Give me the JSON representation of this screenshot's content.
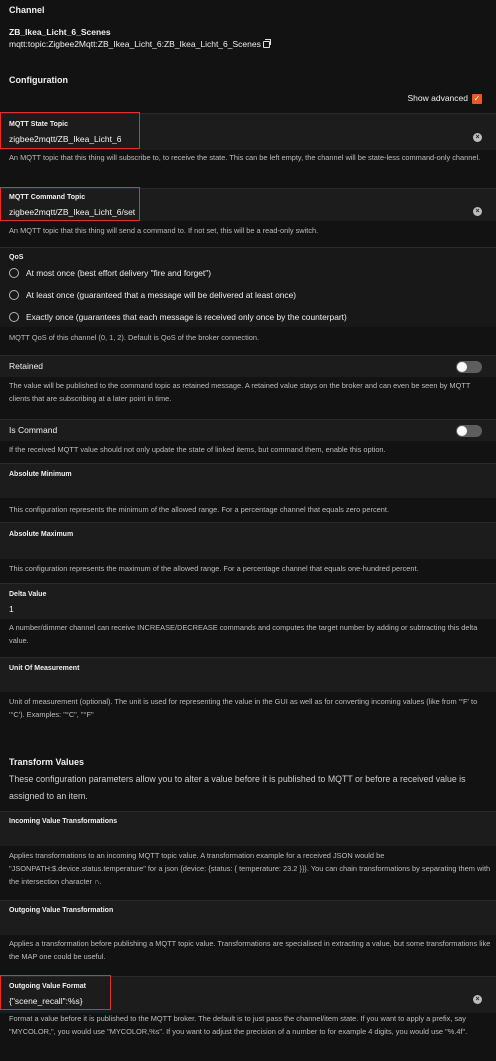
{
  "channel": {
    "heading": "Channel",
    "name": "ZB_Ikea_Licht_6_Scenes",
    "uid": "mqtt:topic:Zigbee2Mqtt:ZB_Ikea_Licht_6:ZB_Ikea_Licht_6_Scenes"
  },
  "configuration": {
    "heading": "Configuration",
    "show_advanced_label": "Show advanced",
    "show_advanced_checked": true
  },
  "mqtt_state_topic": {
    "label": "MQTT State Topic",
    "value": "zigbee2mqtt/ZB_Ikea_Licht_6",
    "hint": "An MQTT topic that this thing will subscribe to, to receive the state. This can be left empty, the channel will be state-less command-only channel."
  },
  "mqtt_command_topic": {
    "label": "MQTT Command Topic",
    "value": "zigbee2mqtt/ZB_Ikea_Licht_6/set",
    "hint": "An MQTT topic that this thing will send a command to. If not set, this will be a read-only switch."
  },
  "qos": {
    "label": "QoS",
    "options": [
      "At most once (best effort delivery \"fire and forget\")",
      "At least once (guaranteed that a message will be delivered at least once)",
      "Exactly once (guarantees that each message is received only once by the counterpart)"
    ],
    "hint": "MQTT QoS of this channel (0, 1, 2). Default is QoS of the broker connection."
  },
  "retained": {
    "label": "Retained",
    "enabled": false,
    "hint": "The value will be published to the command topic as retained message. A retained value stays on the broker and can even be seen by MQTT clients that are subscribing at a later point in time."
  },
  "is_command": {
    "label": "Is Command",
    "enabled": false,
    "hint": "If the received MQTT value should not only update the state of linked items, but command them, enable this option."
  },
  "absolute_minimum": {
    "label": "Absolute Minimum",
    "value": "",
    "hint": "This configuration represents the minimum of the allowed range. For a percentage channel that equals zero percent."
  },
  "absolute_maximum": {
    "label": "Absolute Maximum",
    "value": "",
    "hint": "This configuration represents the maximum of the allowed range. For a percentage channel that equals one-hundred percent."
  },
  "delta_value": {
    "label": "Delta Value",
    "value": "1",
    "hint": "A number/dimmer channel can receive INCREASE/DECREASE commands and computes the target number by adding or subtracting this delta value."
  },
  "unit_of_measurement": {
    "label": "Unit Of Measurement",
    "value": "",
    "hint": "Unit of measurement (optional). The unit is used for representing the value in the GUI as well as for converting incoming values (like from '°F' to '°C'). Examples: \"°C\", \"°F\""
  },
  "transform_values": {
    "heading": "Transform Values",
    "description": "These configuration parameters allow you to alter a value before it is published to MQTT or before a received value is assigned to an item."
  },
  "incoming_value_transformations": {
    "label": "Incoming Value Transformations",
    "value": "",
    "hint": "Applies transformations to an incoming MQTT topic value. A transformation example for a received JSON would be \"JSONPATH:$.device.status.temperature\" for a json {device: {status: { temperature: 23.2 }}}. You can chain transformations by separating them with the intersection character ∩."
  },
  "outgoing_value_transformation": {
    "label": "Outgoing Value Transformation",
    "value": "",
    "hint": "Applies a transformation before publishing a MQTT topic value. Transformations are specialised in extracting a value, but some transformations like the MAP one could be useful."
  },
  "outgoing_value_format": {
    "label": "Outgoing Value Format",
    "value": "{\"scene_recall\":%s}",
    "hint": "Format a value before it is published to the MQTT broker. The default is to just pass the channel/item state. If you want to apply a prefix, say \"MYCOLOR,\", you would use \"MYCOLOR,%s\". If you want to adjust the precision of a number to for example 4 digits, you would use \"%.4f\"."
  },
  "colors": {
    "background": "#121212",
    "field_background": "#1c1c1c",
    "accent": "#ea5a1f",
    "highlight_box": "#e03030"
  }
}
